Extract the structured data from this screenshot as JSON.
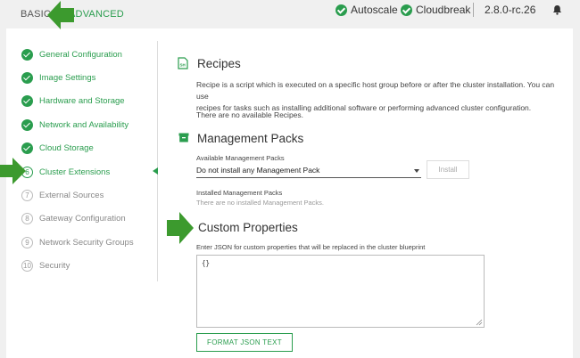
{
  "colors": {
    "accent": "#2a9d4e",
    "arrow": "#3c9a2e"
  },
  "topbar": {
    "mode_basic": "BASIC",
    "mode_advanced": "ADVANCED",
    "autoscale": "Autoscale",
    "cloudbreak": "Cloudbreak",
    "version": "2.8.0-rc.26",
    "bell_icon": "bell-icon"
  },
  "wizard": {
    "steps": [
      {
        "num": "1",
        "label": "General Configuration",
        "state": "done"
      },
      {
        "num": "2",
        "label": "Image Settings",
        "state": "done"
      },
      {
        "num": "3",
        "label": "Hardware and Storage",
        "state": "done"
      },
      {
        "num": "4",
        "label": "Network and Availability",
        "state": "done"
      },
      {
        "num": "5",
        "label": "Cloud Storage",
        "state": "done"
      },
      {
        "num": "6",
        "label": "Cluster Extensions",
        "state": "current"
      },
      {
        "num": "7",
        "label": "External Sources",
        "state": "todo"
      },
      {
        "num": "8",
        "label": "Gateway Configuration",
        "state": "todo"
      },
      {
        "num": "9",
        "label": "Network Security Groups",
        "state": "todo"
      },
      {
        "num": "10",
        "label": "Security",
        "state": "todo"
      }
    ]
  },
  "recipes": {
    "title": "Recipes",
    "description_line1": "Recipe is a script which is executed on a specific host group before or after the cluster installation. You can use",
    "description_line2": "recipes for tasks such as installing additional software or performing advanced cluster configuration.",
    "empty": "There are no available Recipes."
  },
  "mpacks": {
    "title": "Management Packs",
    "available_label": "Available Management Packs",
    "selected": "Do not install any Management Pack",
    "install_label": "Install",
    "installed_label": "Installed Management Packs",
    "installed_empty": "There are no installed Management Packs."
  },
  "custom": {
    "title": "Custom Properties",
    "hint": "Enter JSON for custom properties that will be replaced in the cluster blueprint",
    "json_value": "{}",
    "format_label": "FORMAT JSON TEXT"
  }
}
